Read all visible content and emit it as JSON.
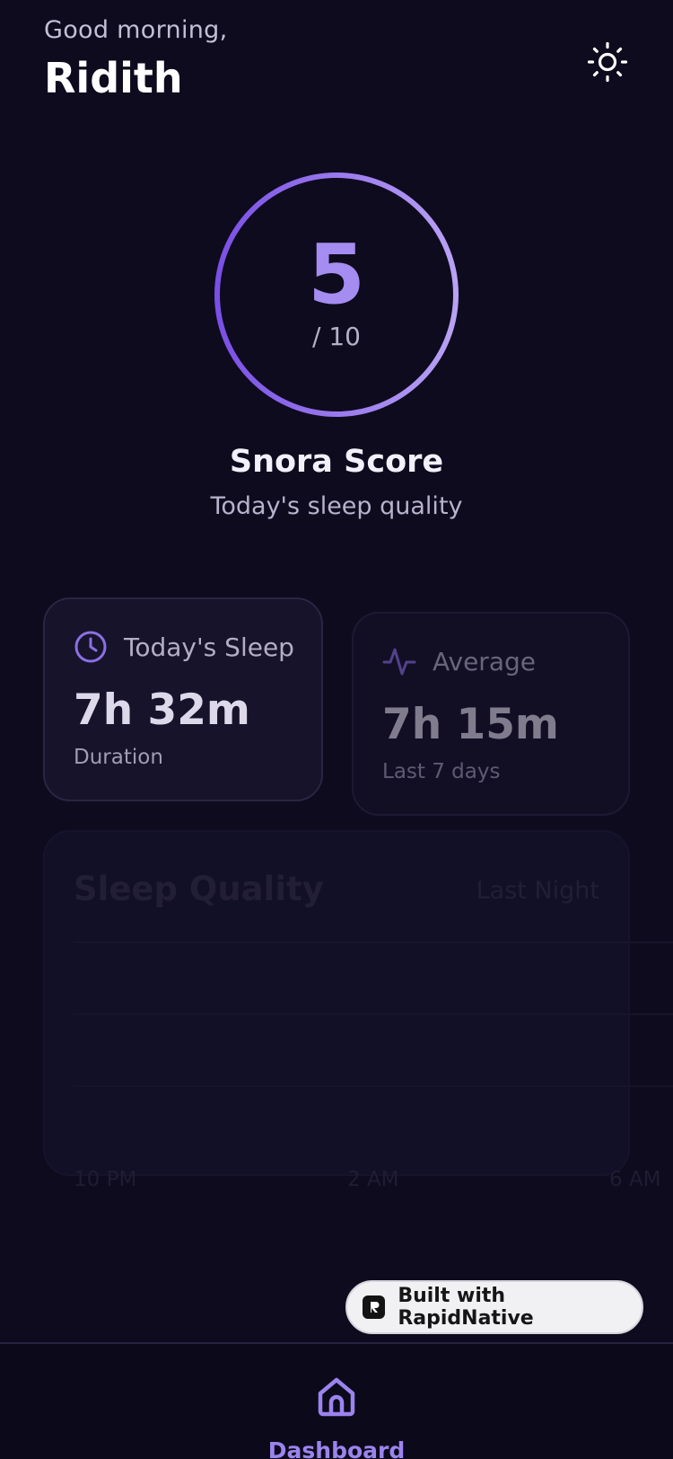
{
  "header": {
    "greeting": "Good morning,",
    "username": "Ridith",
    "theme_icon": "sun-icon"
  },
  "score": {
    "value": "5",
    "max_label": "/ 10",
    "title": "Snora Score",
    "subtitle": "Today's sleep quality",
    "fraction": 1.0
  },
  "stats": {
    "today": {
      "icon": "clock-icon",
      "label": "Today's Sleep",
      "value": "7h 32m",
      "caption": "Duration"
    },
    "average": {
      "icon": "activity-icon",
      "label": "Average",
      "value": "7h 15m",
      "caption": "Last 7 days"
    }
  },
  "sleep_quality": {
    "title": "Sleep Quality",
    "period": "Last Night",
    "x_labels": [
      "10 PM",
      "2 AM",
      "6 AM"
    ]
  },
  "badge": {
    "label": "Built with RapidNative",
    "icon": "rapidnative-logo"
  },
  "tabbar": {
    "active_tab": {
      "label": "Dashboard",
      "icon": "home-icon"
    }
  },
  "colors": {
    "background": "#0e0b1e",
    "accent": "#9b84ee",
    "ring_start": "#7a4fe6",
    "ring_end": "#b9a2f5",
    "card": "#17132b"
  }
}
